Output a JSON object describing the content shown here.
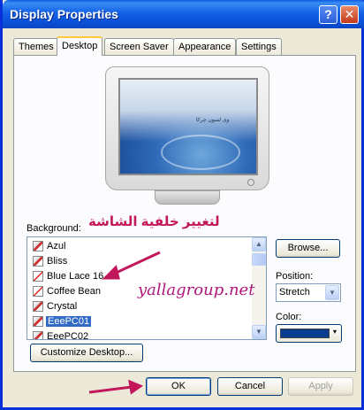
{
  "window": {
    "title": "Display Properties",
    "help_glyph": "?",
    "close_glyph": "✕"
  },
  "tabs": [
    {
      "label": "Themes"
    },
    {
      "label": "Desktop"
    },
    {
      "label": "Screen Saver"
    },
    {
      "label": "Appearance"
    },
    {
      "label": "Settings"
    }
  ],
  "preview": {
    "screen_text": "وی لسون چرکا"
  },
  "background": {
    "label": "Background:",
    "items": [
      {
        "label": "Azul",
        "icon": "bitmap-icon"
      },
      {
        "label": "Bliss",
        "icon": "bitmap-icon"
      },
      {
        "label": "Blue Lace 16",
        "icon": "none-icon"
      },
      {
        "label": "Coffee Bean",
        "icon": "none-icon"
      },
      {
        "label": "Crystal",
        "icon": "bitmap-icon"
      },
      {
        "label": "EeePC01",
        "icon": "bitmap-icon"
      },
      {
        "label": "EeePC02",
        "icon": "bitmap-icon"
      }
    ],
    "selected": "EeePC01"
  },
  "annotation": {
    "arabic": "لتغيير خلفية الشاشة",
    "watermark": "yallagroup.net",
    "arrow_color": "#c2185b"
  },
  "buttons": {
    "browse": "Browse...",
    "customize": "Customize Desktop...",
    "ok": "OK",
    "cancel": "Cancel",
    "apply": "Apply"
  },
  "position": {
    "label": "Position:",
    "value": "Stretch"
  },
  "color": {
    "label": "Color:",
    "value": "#0a3d8f",
    "arrow": "▾"
  },
  "scroll": {
    "up": "▲",
    "down": "▼",
    "select_arrow": "▾"
  }
}
